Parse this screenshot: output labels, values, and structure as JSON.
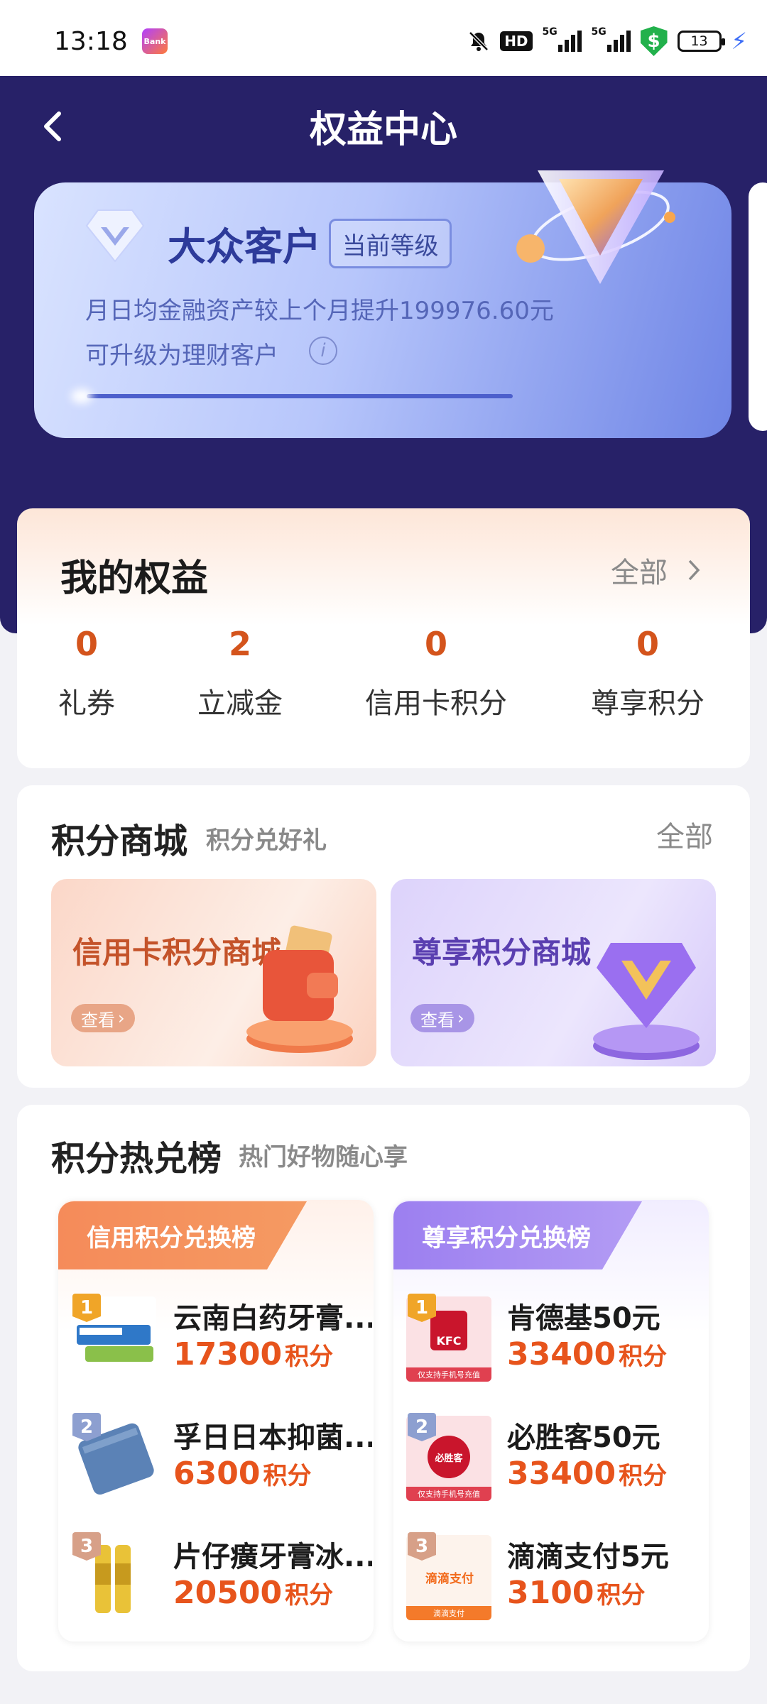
{
  "status_bar": {
    "time": "13:18",
    "app_label": "Bank",
    "hd_label": "HD",
    "signal1_label": "5G",
    "signal2_label": "5G",
    "shield_label": "$",
    "battery": "13"
  },
  "header": {
    "title": "权益中心"
  },
  "tier_card": {
    "tier_name": "大众客户",
    "badge": "当前等级",
    "line1": "月日均金融资产较上个月提升199976.60元",
    "line2": "可升级为理财客户",
    "info_glyph": "i"
  },
  "my_rights": {
    "title": "我的权益",
    "all_label": "全部",
    "stats": [
      {
        "value": "0",
        "label": "礼券"
      },
      {
        "value": "2",
        "label": "立减金"
      },
      {
        "value": "0",
        "label": "信用卡积分"
      },
      {
        "value": "0",
        "label": "尊享积分"
      }
    ]
  },
  "points_mall": {
    "title": "积分商城",
    "subtitle": "积分兑好礼",
    "all_label": "全部",
    "tiles": [
      {
        "title": "信用卡积分商城",
        "button": "查看"
      },
      {
        "title": "尊享积分商城",
        "button": "查看"
      }
    ]
  },
  "hot_list": {
    "title": "积分热兑榜",
    "subtitle": "热门好物随心享",
    "panels": [
      {
        "ribbon": "信用积分兑换榜",
        "items": [
          {
            "rank": "1",
            "name": "云南白药牙膏...",
            "points": "17300",
            "unit": "积分"
          },
          {
            "rank": "2",
            "name": "孚日日本抑菌...",
            "points": "6300",
            "unit": "积分"
          },
          {
            "rank": "3",
            "name": "片仔癀牙膏冰...",
            "points": "20500",
            "unit": "积分"
          }
        ]
      },
      {
        "ribbon": "尊享积分兑换榜",
        "items": [
          {
            "rank": "1",
            "name": "肯德基50元",
            "points": "33400",
            "unit": "积分",
            "thumb_caption": "仅支持手机号充值",
            "thumb_text": "KFC"
          },
          {
            "rank": "2",
            "name": "必胜客50元",
            "points": "33400",
            "unit": "积分",
            "thumb_caption": "仅支持手机号充值",
            "thumb_text": "必胜客"
          },
          {
            "rank": "3",
            "name": "滴滴支付5元",
            "points": "3100",
            "unit": "积分",
            "thumb_caption": "滴滴支付",
            "thumb_text": "滴滴支付"
          }
        ]
      }
    ]
  },
  "colors": {
    "hero_bg": "#272168",
    "accent_orange": "#e7541c",
    "stat_orange": "#d4541c",
    "tier_blue": "#2d3a9a"
  }
}
